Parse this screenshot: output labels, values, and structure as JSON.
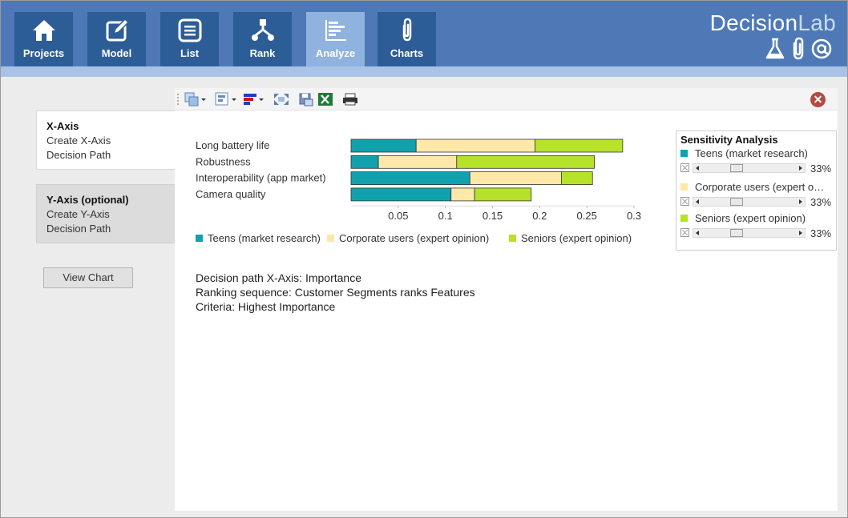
{
  "nav": {
    "items": [
      {
        "label": "Projects",
        "icon": "home-icon"
      },
      {
        "label": "Model",
        "icon": "edit-icon"
      },
      {
        "label": "List",
        "icon": "list-icon"
      },
      {
        "label": "Rank",
        "icon": "rank-icon"
      },
      {
        "label": "Analyze",
        "icon": "analyze-icon",
        "active": true
      },
      {
        "label": "Charts",
        "icon": "paperclip-icon"
      }
    ]
  },
  "brand": {
    "name_main": "Decision",
    "name_accent": "Lab"
  },
  "left_panel": {
    "x_axis": {
      "title": "X-Axis",
      "line1": "Create X-Axis",
      "line2": "Decision Path"
    },
    "y_axis": {
      "title": "Y-Axis (optional)",
      "line1": "Create Y-Axis",
      "line2": "Decision Path"
    },
    "view_chart": "View Chart"
  },
  "colors": {
    "teens": "#11a1ad",
    "corporate": "#fde8a8",
    "seniors": "#b6e22a",
    "nav_bg": "#4e79b6",
    "nav_button": "#2d5d96",
    "nav_active": "#8fb2df"
  },
  "chart_data": {
    "type": "bar",
    "orientation": "horizontal",
    "stacked": true,
    "categories": [
      "Long battery life",
      "Robustness",
      "Interoperability (app market)",
      "Camera quality"
    ],
    "series": [
      {
        "name": "Teens (market research)",
        "values": [
          0.069,
          0.029,
          0.126,
          0.106
        ]
      },
      {
        "name": "Corporate users (expert opinion)",
        "values": [
          0.126,
          0.083,
          0.097,
          0.025
        ]
      },
      {
        "name": "Seniors (expert opinion)",
        "values": [
          0.093,
          0.146,
          0.033,
          0.06
        ]
      }
    ],
    "xlim": [
      0,
      0.3
    ],
    "xticks": [
      "0.05",
      "0.1",
      "0.15",
      "0.2",
      "0.25",
      "0.3"
    ],
    "legend_position": "bottom"
  },
  "notes": {
    "line1": "Decision path X-Axis: Importance",
    "line2": "Ranking sequence: Customer Segments ranks Features",
    "line3": "Criteria: Highest Importance"
  },
  "sensitivity": {
    "title": "Sensitivity Analysis",
    "items": [
      {
        "label": "Teens (market research)",
        "percent": "33%",
        "value": 0.33
      },
      {
        "label": "Corporate users (expert o…",
        "percent": "33%",
        "value": 0.33
      },
      {
        "label": "Seniors (expert opinion)",
        "percent": "33%",
        "value": 0.33
      }
    ]
  }
}
